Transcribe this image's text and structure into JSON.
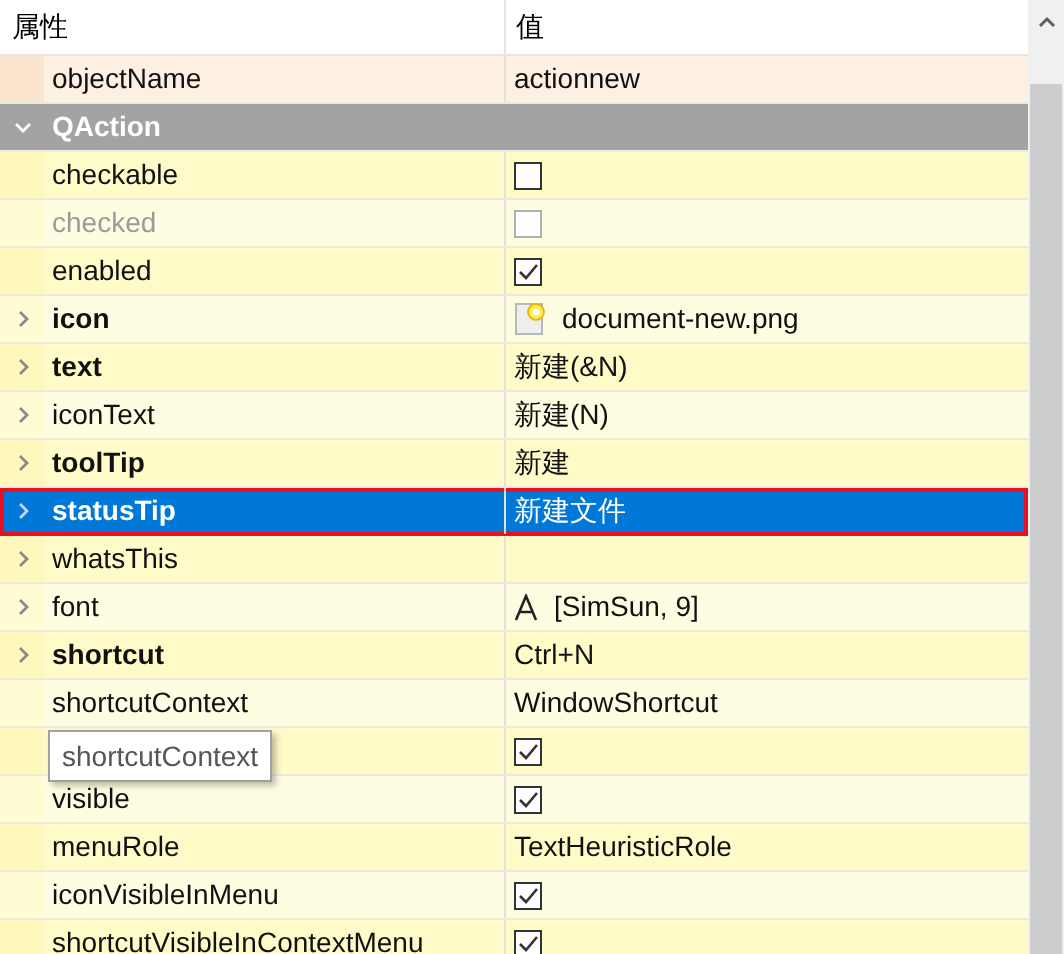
{
  "header": {
    "columns": [
      "属性",
      "值"
    ]
  },
  "rows": [
    {
      "kind": "prop",
      "name": "objectName",
      "bold": false,
      "disabled": false,
      "expandable": false,
      "selected": false,
      "value": {
        "kind": "text",
        "text": "actionnew"
      }
    },
    {
      "kind": "group",
      "name": "QAction",
      "expanded": true
    },
    {
      "kind": "prop",
      "name": "checkable",
      "bold": false,
      "disabled": false,
      "expandable": false,
      "selected": false,
      "value": {
        "kind": "checkbox",
        "checked": false
      }
    },
    {
      "kind": "prop",
      "name": "checked",
      "bold": false,
      "disabled": true,
      "expandable": false,
      "selected": false,
      "value": {
        "kind": "checkbox",
        "checked": false
      }
    },
    {
      "kind": "prop",
      "name": "enabled",
      "bold": false,
      "disabled": false,
      "expandable": false,
      "selected": false,
      "value": {
        "kind": "checkbox",
        "checked": true
      }
    },
    {
      "kind": "prop",
      "name": "icon",
      "bold": true,
      "disabled": false,
      "expandable": true,
      "selected": false,
      "value": {
        "kind": "icon",
        "text": "document-new.png"
      }
    },
    {
      "kind": "prop",
      "name": "text",
      "bold": true,
      "disabled": false,
      "expandable": true,
      "selected": false,
      "value": {
        "kind": "text",
        "text": "新建(&N)"
      }
    },
    {
      "kind": "prop",
      "name": "iconText",
      "bold": false,
      "disabled": false,
      "expandable": true,
      "selected": false,
      "value": {
        "kind": "text",
        "text": "新建(N)"
      }
    },
    {
      "kind": "prop",
      "name": "toolTip",
      "bold": true,
      "disabled": false,
      "expandable": true,
      "selected": false,
      "value": {
        "kind": "text",
        "text": "新建"
      }
    },
    {
      "kind": "prop",
      "name": "statusTip",
      "bold": true,
      "disabled": false,
      "expandable": true,
      "selected": true,
      "value": {
        "kind": "text",
        "text": "新建文件"
      }
    },
    {
      "kind": "prop",
      "name": "whatsThis",
      "bold": false,
      "disabled": false,
      "expandable": true,
      "selected": false
    },
    {
      "kind": "prop",
      "name": "font",
      "bold": false,
      "disabled": false,
      "expandable": true,
      "selected": false,
      "value": {
        "kind": "font",
        "text": "[SimSun, 9]"
      }
    },
    {
      "kind": "prop",
      "name": "shortcut",
      "bold": true,
      "disabled": false,
      "expandable": true,
      "selected": false,
      "value": {
        "kind": "text",
        "text": "Ctrl+N"
      }
    },
    {
      "kind": "prop",
      "name": "shortcutContext",
      "bold": false,
      "disabled": false,
      "expandable": false,
      "selected": false,
      "value": {
        "kind": "text",
        "text": "WindowShortcut"
      }
    },
    {
      "kind": "prop",
      "expandable": false,
      "selected": false,
      "tooltip": "shortcutContext",
      "value": {
        "kind": "checkbox",
        "checked": true
      }
    },
    {
      "kind": "prop",
      "name": "visible",
      "bold": false,
      "disabled": false,
      "expandable": false,
      "selected": false,
      "value": {
        "kind": "checkbox",
        "checked": true
      }
    },
    {
      "kind": "prop",
      "name": "menuRole",
      "bold": false,
      "disabled": false,
      "expandable": false,
      "selected": false,
      "value": {
        "kind": "text",
        "text": "TextHeuristicRole"
      }
    },
    {
      "kind": "prop",
      "name": "iconVisibleInMenu",
      "bold": false,
      "disabled": false,
      "expandable": false,
      "selected": false,
      "value": {
        "kind": "checkbox",
        "checked": true
      }
    },
    {
      "kind": "prop",
      "name": "shortcutVisibleInContextMenu",
      "bold": false,
      "disabled": false,
      "expandable": false,
      "selected": false,
      "value": {
        "kind": "checkbox",
        "checked": true
      }
    }
  ]
}
